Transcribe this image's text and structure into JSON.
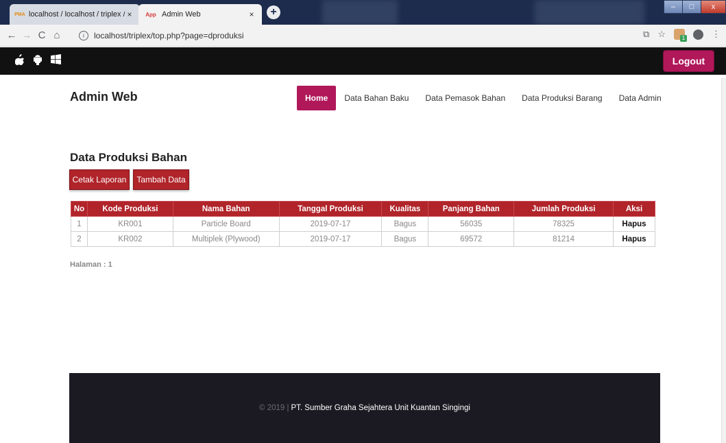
{
  "browser": {
    "tabs": [
      {
        "favicon": "PMA",
        "title": "localhost / localhost / triplex / p",
        "close": "×"
      },
      {
        "favicon": "App",
        "title": "Admin Web",
        "close": "×"
      }
    ],
    "new_tab": "+",
    "url": "localhost/triplex/top.php?page=dproduksi",
    "window_controls": {
      "minimize": "–",
      "maximize": "□",
      "close": "x"
    }
  },
  "topbar": {
    "os_icons": [
      "apple-icon",
      "android-icon",
      "windows-icon"
    ],
    "logout_label": "Logout"
  },
  "header": {
    "brand": "Admin Web",
    "nav": [
      {
        "label": "Home",
        "active": true
      },
      {
        "label": "Data Bahan Baku",
        "active": false
      },
      {
        "label": "Data Pemasok Bahan",
        "active": false
      },
      {
        "label": "Data Produksi Barang",
        "active": false
      },
      {
        "label": "Data Admin",
        "active": false
      }
    ]
  },
  "main": {
    "title": "Data Produksi Bahan",
    "btn_cetak": "Cetak Laporan",
    "btn_tambah": "Tambah Data",
    "table": {
      "columns": [
        "No",
        "Kode Produksi",
        "Nama Bahan",
        "Tanggal Produksi",
        "Kualitas",
        "Panjang Bahan",
        "Jumlah Produksi",
        "Aksi"
      ],
      "rows": [
        [
          "1",
          "KR001",
          "Particle Board",
          "2019-07-17",
          "Bagus",
          "56035",
          "78325",
          "Hapus"
        ],
        [
          "2",
          "KR002",
          "Multiplek (Plywood)",
          "2019-07-17",
          "Bagus",
          "69572",
          "81214",
          "Hapus"
        ]
      ]
    },
    "pagination": "Halaman : 1"
  },
  "footer": {
    "copyright": "© 2019 |",
    "company": "PT. Sumber Graha Sejahtera Unit Kuantan Singingi"
  },
  "colors": {
    "primary": "#b0185a",
    "table_header": "#b0242a",
    "topbar": "#111111",
    "footer": "#1b1a22"
  }
}
